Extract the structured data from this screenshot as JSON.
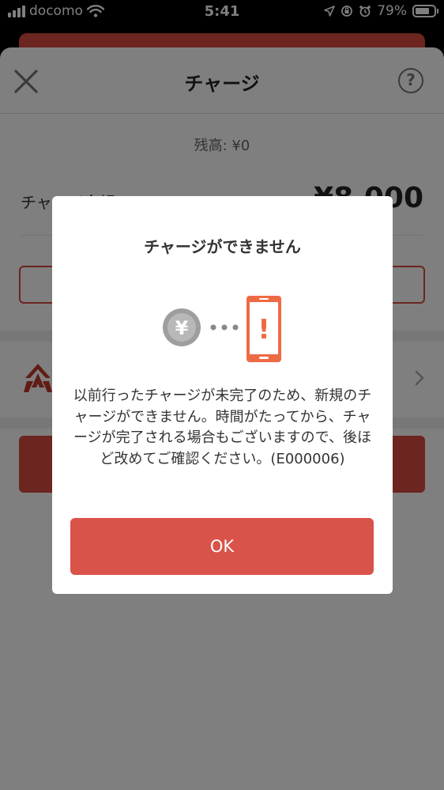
{
  "status_bar": {
    "carrier": "docomo",
    "time": "5:41",
    "battery": "79%",
    "battery_level": 0.79
  },
  "sheet": {
    "title": "チャージ",
    "help_symbol": "?",
    "balance": "残高: ¥0",
    "amount_label": "チャージ金額",
    "amount_value": "¥8,000"
  },
  "dialog": {
    "title": "チャージができません",
    "message": "以前行ったチャージが未完了のため、新規のチャージができません。時間がたってから、チャージが完了される場合もございますので、後ほど改めてご確認ください。(E000006)",
    "ok_label": "OK",
    "yen_symbol": "¥",
    "exclamation": "!"
  },
  "colors": {
    "accent": "#d94a3f",
    "phone_orange": "#ee6a45",
    "coin_gray": "#9e9e9e"
  },
  "icons": [
    "close-icon",
    "help-icon",
    "chevron-right-icon",
    "yen-coin-icon",
    "phone-alert-icon",
    "location-icon",
    "alarm-icon",
    "wifi-icon"
  ]
}
